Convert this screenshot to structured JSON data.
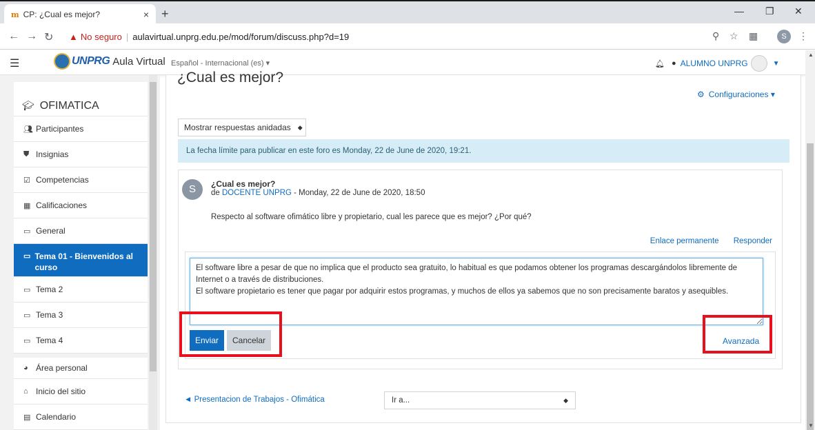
{
  "browser": {
    "tab_title": "CP: ¿Cual es mejor?",
    "tab_favicon": "moodle-icon",
    "tab_close": "×",
    "new_tab": "+",
    "insecure_label": "No seguro",
    "separator": "|",
    "url": "aulavirtual.unprg.edu.pe/mod/forum/discuss.php?d=19",
    "profile_initial": "S",
    "minimize": "—",
    "restore": "❐",
    "close": "✕"
  },
  "navbar": {
    "brand_logo_text": "UNPRG",
    "brand_name": "Aula Virtual",
    "language": "Español - Internacional (es) ▾",
    "user_name": "ALUMNO UNPRG"
  },
  "drawer": {
    "course": "OFIMATICA",
    "items": [
      {
        "label": "Participantes",
        "icon": "users-icon"
      },
      {
        "label": "Insignias",
        "icon": "shield-icon"
      },
      {
        "label": "Competencias",
        "icon": "checkbox-icon"
      },
      {
        "label": "Calificaciones",
        "icon": "table-icon"
      },
      {
        "label": "General",
        "icon": "folder-icon"
      },
      {
        "label": "Tema 01 - Bienvenidos al curso",
        "icon": "folder-icon",
        "active": true
      },
      {
        "label": "Tema 2",
        "icon": "folder-icon"
      },
      {
        "label": "Tema 3",
        "icon": "folder-icon"
      },
      {
        "label": "Tema 4",
        "icon": "folder-icon"
      },
      {
        "label": "Área personal",
        "icon": "dashboard-icon"
      },
      {
        "label": "Inicio del sitio",
        "icon": "home-icon"
      },
      {
        "label": "Calendario",
        "icon": "calendar-icon"
      }
    ]
  },
  "main": {
    "title": "¿Cual es mejor?",
    "settings_label": "Configuraciones",
    "display_mode": "Mostrar respuestas anidadas",
    "deadline_alert": "La fecha límite para publicar en este foro es Monday, 22 de June de 2020, 19:21.",
    "post": {
      "avatar_initial": "S",
      "subject": "¿Cual es mejor?",
      "by_prefix": "de",
      "author": "DOCENTE UNPRG",
      "date": "- Monday, 22 de June de 2020, 18:50",
      "message": "Respecto al software ofimático libre y propietario, cual les parece que es mejor? ¿Por qué?",
      "permalink": "Enlace permanente",
      "reply": "Responder"
    },
    "reply_form": {
      "text": "El software libre a pesar de que no implica que el producto sea gratuito, lo habitual es que podamos obtener los programas descargándolos libremente de Internet o a través de distribuciones.\nEl software propietario es tener que pagar por adquirir estos programas, y muchos de ellos ya sabemos que no son precisamente baratos y asequibles.",
      "submit": "Enviar",
      "cancel": "Cancelar",
      "advanced": "Avanzada"
    },
    "prev_activity": "◄ Presentacion de Trabajos - Ofimática",
    "jump_to": "Ir a..."
  },
  "colors": {
    "primary": "#0f6cbf",
    "alert_bg": "#d6ecf6",
    "highlight": "#e8101c"
  }
}
